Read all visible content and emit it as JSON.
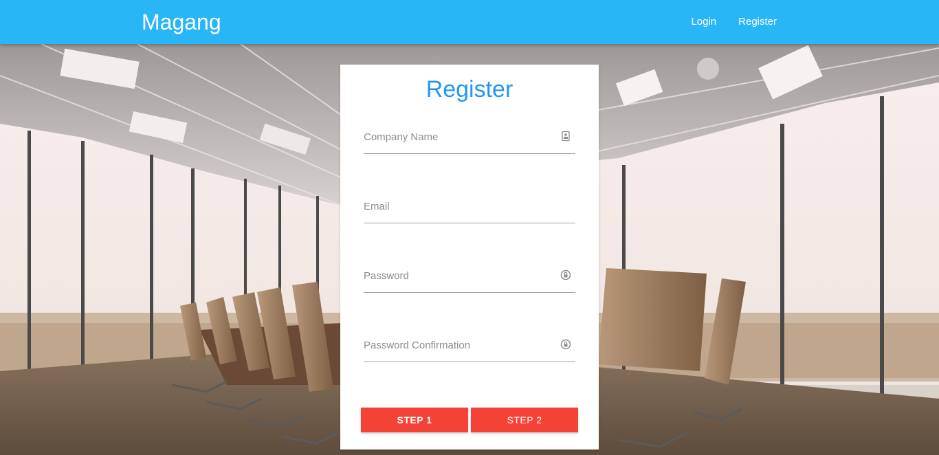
{
  "colors": {
    "navbar": "#29b6f6",
    "title": "#2196f3",
    "button": "#f44336"
  },
  "navbar": {
    "brand": "Magang",
    "links": [
      {
        "label": "Login"
      },
      {
        "label": "Register"
      }
    ]
  },
  "form": {
    "title": "Register",
    "fields": [
      {
        "placeholder": "Company Name",
        "value": "",
        "icon": "id-card-icon"
      },
      {
        "placeholder": "Email",
        "value": "",
        "icon": ""
      },
      {
        "placeholder": "Password",
        "value": "",
        "icon": "lock-icon"
      },
      {
        "placeholder": "Password Confirmation",
        "value": "",
        "icon": "lock-icon"
      }
    ],
    "buttons": [
      {
        "label": "STEP 1"
      },
      {
        "label": "STEP 2"
      }
    ]
  }
}
